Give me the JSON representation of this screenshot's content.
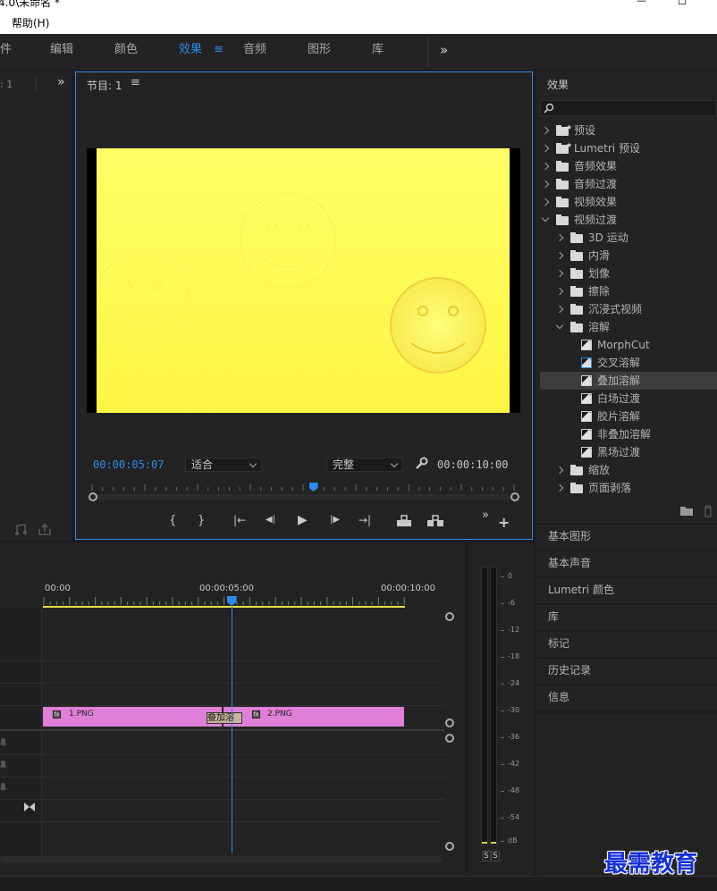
{
  "window": {
    "title": "4.0\\未命名 *",
    "min_btn": "—",
    "max_btn": "☐"
  },
  "menu": {
    "help": "帮助(H)"
  },
  "workspaces": {
    "items": [
      "件",
      "编辑",
      "颜色",
      "效果",
      "音频",
      "图形",
      "库"
    ],
    "active": "效果",
    "menu_icon": "≡",
    "overflow": "»"
  },
  "project_panel": {
    "label": ": 1",
    "overflow": "»"
  },
  "program_monitor": {
    "title": "节目: 1",
    "menu_icon": "≡",
    "timecode_current": "00:00:05:07",
    "zoom_select": "适合",
    "quality_select": "完整",
    "timecode_total": "00:00:10:00",
    "playhead_fraction": 0.52,
    "colors": {
      "accent": "#2d8ceb",
      "frame_yellow": "#ffff5a"
    }
  },
  "transport": {
    "mark_in": "{",
    "mark_out": "}",
    "go_in": "|←",
    "step_back": "◀|",
    "play": "▶",
    "step_fwd": "|▶",
    "go_out": "→|",
    "lift": "lift-icon",
    "extract": "extract-icon",
    "overflow": "»",
    "add": "+"
  },
  "effects_panel": {
    "title": "效果",
    "search_placeholder": "",
    "tree": [
      {
        "label": "预设",
        "level": 0,
        "kind": "folder-star",
        "open": false
      },
      {
        "label": "Lumetri 预设",
        "level": 0,
        "kind": "folder-star",
        "open": false
      },
      {
        "label": "音频效果",
        "level": 0,
        "kind": "folder",
        "open": false
      },
      {
        "label": "音频过渡",
        "level": 0,
        "kind": "folder",
        "open": false
      },
      {
        "label": "视频效果",
        "level": 0,
        "kind": "folder",
        "open": false
      },
      {
        "label": "视频过渡",
        "level": 0,
        "kind": "folder",
        "open": true
      },
      {
        "label": "3D 运动",
        "level": 1,
        "kind": "folder",
        "open": false
      },
      {
        "label": "内滑",
        "level": 1,
        "kind": "folder",
        "open": false
      },
      {
        "label": "划像",
        "level": 1,
        "kind": "folder",
        "open": false
      },
      {
        "label": "擦除",
        "level": 1,
        "kind": "folder",
        "open": false
      },
      {
        "label": "沉浸式视频",
        "level": 1,
        "kind": "folder",
        "open": false
      },
      {
        "label": "溶解",
        "level": 1,
        "kind": "folder",
        "open": true
      },
      {
        "label": "MorphCut",
        "level": 2,
        "kind": "effect"
      },
      {
        "label": "交叉溶解",
        "level": 2,
        "kind": "effect",
        "default": true
      },
      {
        "label": "叠加溶解",
        "level": 2,
        "kind": "effect",
        "selected": true
      },
      {
        "label": "白场过渡",
        "level": 2,
        "kind": "effect"
      },
      {
        "label": "胶片溶解",
        "level": 2,
        "kind": "effect"
      },
      {
        "label": "非叠加溶解",
        "level": 2,
        "kind": "effect"
      },
      {
        "label": "黑场过渡",
        "level": 2,
        "kind": "effect"
      },
      {
        "label": "缩放",
        "level": 1,
        "kind": "folder",
        "open": false
      },
      {
        "label": "页面剥落",
        "level": 1,
        "kind": "folder",
        "open": false
      }
    ]
  },
  "side_panels": [
    "基本图形",
    "基本声音",
    "Lumetri 颜色",
    "库",
    "标记",
    "历史记录",
    "信息"
  ],
  "timeline": {
    "ruler": [
      "00:00",
      "00:00:05:00",
      "00:00:10:00"
    ],
    "playhead_fraction": 0.52,
    "clips": [
      {
        "name": "1.PNG",
        "fx": "fx"
      },
      {
        "name": "2.PNG",
        "fx": "fx"
      }
    ],
    "transition_label": "叠加溶"
  },
  "audio_meter": {
    "scale": [
      "0",
      "-6",
      "-12",
      "-18",
      "-24",
      "-30",
      "-36",
      "-42",
      "-48",
      "-54",
      "dB"
    ],
    "solo": [
      "S",
      "S"
    ]
  },
  "watermark": "最需教育"
}
